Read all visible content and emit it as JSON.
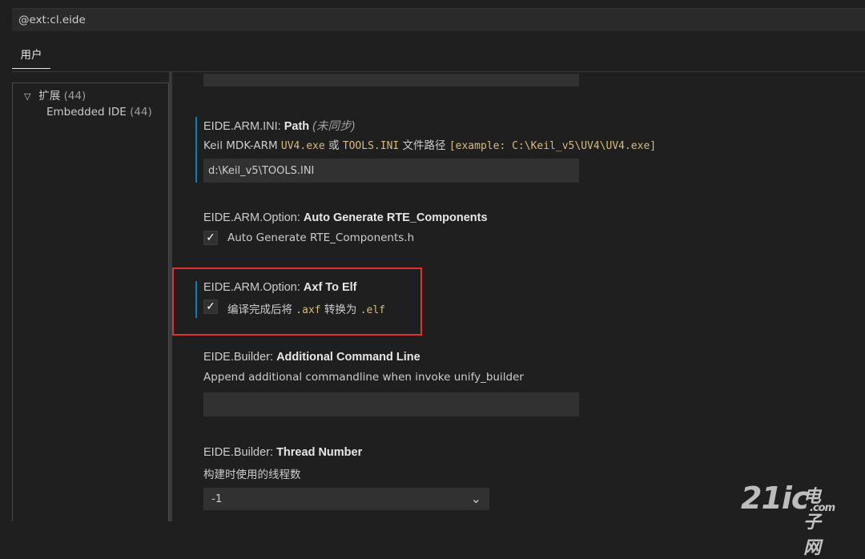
{
  "search": {
    "value": "@ext:cl.eide"
  },
  "tabs": [
    {
      "label": "用户"
    }
  ],
  "tree": {
    "group": {
      "label": "扩展",
      "count": "(44)"
    },
    "child": {
      "label": "Embedded IDE",
      "count": "(44)"
    }
  },
  "settings": {
    "ini_path": {
      "category": "EIDE.ARM.INI: ",
      "name": "Path",
      "tag": "(未同步)",
      "desc_prefix": "Keil MDK-ARM ",
      "desc_code1": "UV4.exe",
      "desc_or": " 或 ",
      "desc_code2": "TOOLS.INI",
      "desc_mid": " 文件路径 ",
      "desc_example": "[example: C:\\Keil_v5\\UV4\\UV4.exe]",
      "value": "d:\\Keil_v5\\TOOLS.INI"
    },
    "rte": {
      "category": "EIDE.ARM.Option: ",
      "name": "Auto Generate RTE_Components",
      "checked": "✓",
      "label": "Auto Generate RTE_Components.h"
    },
    "axf": {
      "category": "EIDE.ARM.Option: ",
      "name": "Axf To Elf",
      "checked": "✓",
      "label_prefix": "编译完成后将 ",
      "code1": ".axf",
      "label_mid": " 转换为 ",
      "code2": ".elf"
    },
    "cmdline": {
      "category": "EIDE.Builder: ",
      "name": "Additional Command Line",
      "desc": "Append additional commandline when invoke unify_builder",
      "value": ""
    },
    "threads": {
      "category": "EIDE.Builder: ",
      "name": "Thread Number",
      "desc": "构建时使用的线程数",
      "value": "-1",
      "chevron": "⌄"
    }
  },
  "watermark": {
    "main": "21ic",
    "sub": "电子网",
    "sub2": ".com"
  },
  "colors": {
    "accent": "#0a7fb3",
    "highlight": "#e03030",
    "code": "#d7ba7d"
  }
}
